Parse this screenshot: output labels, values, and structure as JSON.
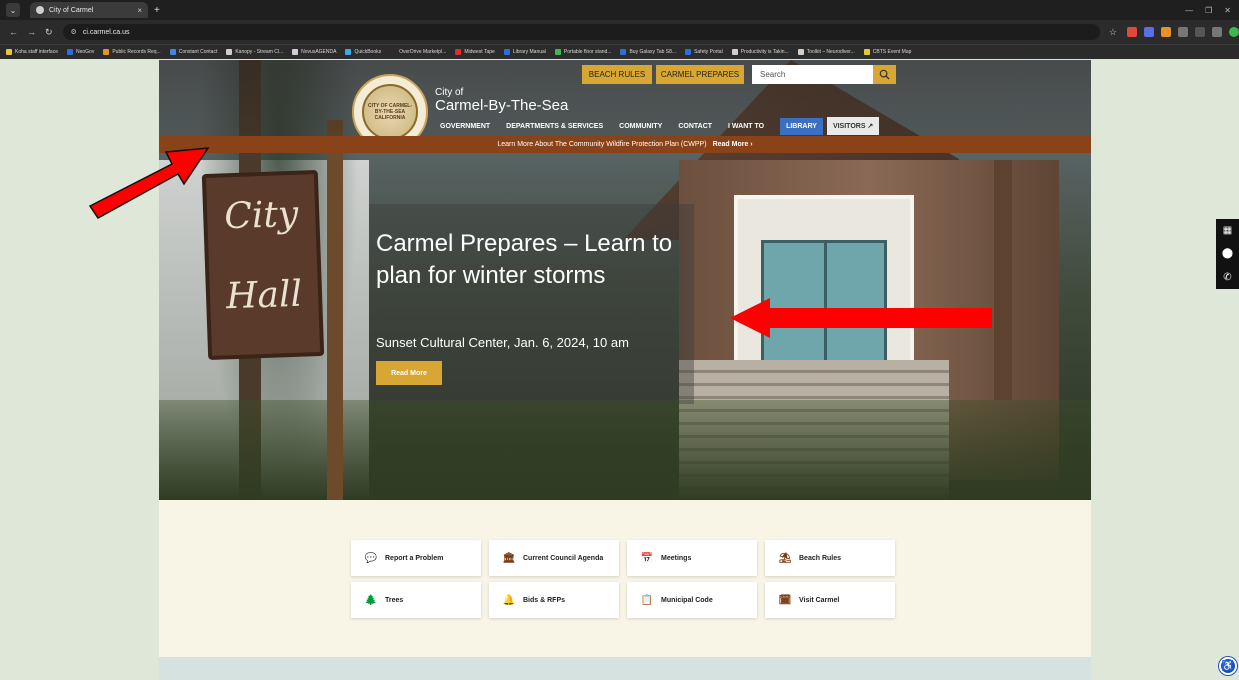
{
  "browser": {
    "tab_title": "City of Carmel",
    "tab_close": "×",
    "new_tab": "+",
    "url": "ci.carmel.ca.us",
    "bookmarks": [
      {
        "label": "Koha staff interface",
        "color": "#e7c63a"
      },
      {
        "label": "NeoGov",
        "color": "#2f6ed8"
      },
      {
        "label": "Public Records Req...",
        "color": "#e8902c"
      },
      {
        "label": "Constant Contact",
        "color": "#3f86e8"
      },
      {
        "label": "Kanopy - Stream Cl...",
        "color": "#cfcfcf"
      },
      {
        "label": "NovusAGENDA",
        "color": "#cfcfcf"
      },
      {
        "label": "QuickBooks",
        "color": "#3da9e8"
      },
      {
        "label": "OverDrive Marketpl...",
        "color": "#2b2b2b"
      },
      {
        "label": "Midwest Tape",
        "color": "#d9302c"
      },
      {
        "label": "Library Manual",
        "color": "#2f6ed8"
      },
      {
        "label": "Portable floor stand...",
        "color": "#3dba4e"
      },
      {
        "label": "Buy Galaxy Tab S8...",
        "color": "#2f6ed8"
      },
      {
        "label": "Safety Portal",
        "color": "#2f6ed8"
      },
      {
        "label": "Productivity is Takin...",
        "color": "#cfcfcf"
      },
      {
        "label": "Toolkit – Neurodiver...",
        "color": "#cfcfcf"
      },
      {
        "label": "CBTS Event Map",
        "color": "#e7c63a"
      }
    ]
  },
  "site": {
    "quick_links": {
      "beach_rules": "BEACH RULES",
      "carmel_prepares": "CARMEL PREPARES"
    },
    "search_placeholder": "Search",
    "brand_small": "City of",
    "brand_big": "Carmel-By-The-Sea",
    "seal_text": "CITY OF CARMEL-BY-THE-SEA CALIFORNIA",
    "nav": [
      "GOVERNMENT",
      "DEPARTMENTS & SERVICES",
      "COMMUNITY",
      "CONTACT",
      "I WANT TO"
    ],
    "nav_library": "LIBRARY",
    "nav_visitors": "VISITORS ↗",
    "alert_text": "Learn More About The Community Wildfire Protection Plan (CWPP)",
    "alert_link": "Read More ›",
    "sign_line1": "City",
    "sign_line2": "Hall",
    "hero": {
      "title": "Carmel Prepares – Learn to plan for winter storms",
      "subtitle": "Sunset Cultural Center, Jan. 6, 2024, 10 am",
      "button": "Read More"
    },
    "tiles": [
      {
        "label": "Report a Problem",
        "icon": "chat-icon",
        "glyph": "💬"
      },
      {
        "label": "Current Council Agenda",
        "icon": "building-icon",
        "glyph": "🏛"
      },
      {
        "label": "Meetings",
        "icon": "calendar-icon",
        "glyph": "📅"
      },
      {
        "label": "Beach Rules",
        "icon": "beach-icon",
        "glyph": "⛱"
      },
      {
        "label": "Trees",
        "icon": "tree-icon",
        "glyph": "🌲"
      },
      {
        "label": "Bids & RFPs",
        "icon": "bell-icon",
        "glyph": "🔔"
      },
      {
        "label": "Municipal Code",
        "icon": "clipboard-icon",
        "glyph": "📋"
      },
      {
        "label": "Visit Carmel",
        "icon": "calendar-grid-icon",
        "glyph": "🗓"
      }
    ]
  },
  "colors": {
    "accent_gold": "#d8a633",
    "alert_brown": "#8a4219",
    "library_blue": "#3b6fc2",
    "arrow_red": "#ff0000"
  }
}
